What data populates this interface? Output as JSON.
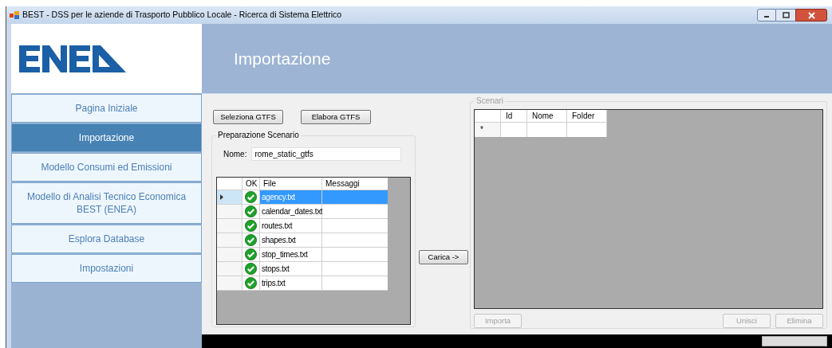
{
  "window": {
    "title": "BEST - DSS per le aziende di Trasporto Pubblico Locale - Ricerca di Sistema Elettrico"
  },
  "header": {
    "title": "Importazione"
  },
  "sidebar": {
    "items": [
      {
        "label": "Pagina Iniziale",
        "selected": false
      },
      {
        "label": "Importazione",
        "selected": true
      },
      {
        "label": "Modello Consumi ed Emissioni",
        "selected": false
      },
      {
        "label": "Modello di Analisi Tecnico Economica BEST (ENEA)",
        "selected": false
      },
      {
        "label": "Esplora Database",
        "selected": false
      },
      {
        "label": "Impostazioni",
        "selected": false
      }
    ]
  },
  "toolbar": {
    "buttons": [
      {
        "label": "Seleziona GTFS",
        "disabled": false
      },
      {
        "label": "Elabora GTFS",
        "disabled": false
      }
    ]
  },
  "preparation": {
    "title": "Preparazione Scenario",
    "name_label": "Nome:",
    "name_value": "rome_static_gtfs",
    "columns": [
      "OK",
      "File",
      "Messaggi"
    ],
    "rows": [
      {
        "ok": true,
        "file": "agency.txt",
        "selected": true
      },
      {
        "ok": true,
        "file": "calendar_dates.txt",
        "selected": false
      },
      {
        "ok": true,
        "file": "routes.txt",
        "selected": false
      },
      {
        "ok": true,
        "file": "shapes.txt",
        "selected": false
      },
      {
        "ok": true,
        "file": "stop_times.txt",
        "selected": false
      },
      {
        "ok": true,
        "file": "stops.txt",
        "selected": false
      },
      {
        "ok": true,
        "file": "trips.txt",
        "selected": false
      }
    ]
  },
  "load_button": {
    "label": "Carica ->",
    "disabled": false
  },
  "scenarios": {
    "title": "Scenari",
    "columns": [
      "Id",
      "Nome",
      "Folder"
    ],
    "new_row_marker": "*",
    "buttons": [
      {
        "label": "Importa",
        "disabled": true
      },
      {
        "label": "Unisci",
        "disabled": true
      },
      {
        "label": "Elimina",
        "disabled": true
      }
    ]
  }
}
